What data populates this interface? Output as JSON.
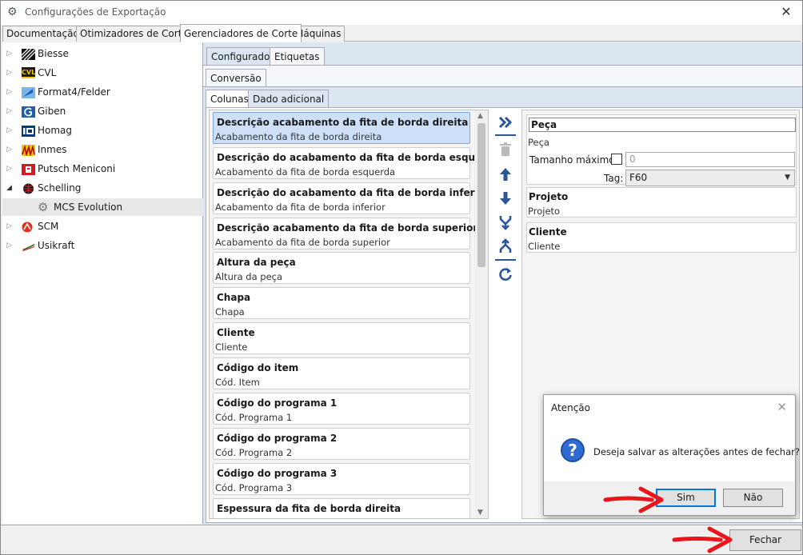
{
  "window": {
    "title": "Configurações de Exportação",
    "close": "✕"
  },
  "main_tabs": [
    {
      "label": "Documentação"
    },
    {
      "label": "Otimizadores de Corte"
    },
    {
      "label": "Gerenciadores de Corte"
    },
    {
      "label": "Máquinas"
    }
  ],
  "tree": [
    {
      "label": "Biesse"
    },
    {
      "label": "CVL"
    },
    {
      "label": "Format4/Felder"
    },
    {
      "label": "Giben"
    },
    {
      "label": "Homag"
    },
    {
      "label": "Inmes"
    },
    {
      "label": "Putsch Meniconi"
    },
    {
      "label": "Schelling"
    },
    {
      "label": "MCS Evolution"
    },
    {
      "label": "SCM"
    },
    {
      "label": "Usikraft"
    }
  ],
  "tree_logo_texts": {
    "cvl": "CVL"
  },
  "sub_tabs": [
    {
      "label": "Configurador"
    },
    {
      "label": "Etiquetas"
    }
  ],
  "conversion_tab": "Conversão",
  "column_tabs": [
    {
      "label": "Colunas"
    },
    {
      "label": "Dado adicional"
    }
  ],
  "columns": [
    {
      "title": "Descrição acabamento da fita de borda direita",
      "sub": "Acabamento da fita de borda direita"
    },
    {
      "title": "Descrição do acabamento da fita de borda esquerda",
      "sub": "Acabamento da fita de borda esquerda"
    },
    {
      "title": "Descrição do acabamento da fita de borda inferior",
      "sub": "Acabamento da fita de borda inferior"
    },
    {
      "title": "Descrição acabamento da fita de borda superior",
      "sub": "Acabamento da fita de borda superior"
    },
    {
      "title": "Altura da peça",
      "sub": "Altura da peça"
    },
    {
      "title": "Chapa",
      "sub": "Chapa"
    },
    {
      "title": "Cliente",
      "sub": "Cliente"
    },
    {
      "title": "Código do item",
      "sub": "Cód. Item"
    },
    {
      "title": "Código do programa 1",
      "sub": "Cód. Programa 1"
    },
    {
      "title": "Código do programa 2",
      "sub": "Cód. Programa 2"
    },
    {
      "title": "Código do programa 3",
      "sub": "Cód. Programa 3"
    },
    {
      "title": "Espessura da fita de borda direita",
      "sub": ""
    }
  ],
  "props": {
    "peca": {
      "input_value": "Peça",
      "sub": "Peça",
      "max_label": "Tamanho máximo:",
      "max_value": "0",
      "tag_label": "Tag:",
      "tag_value": "F60"
    },
    "projeto": {
      "title": "Projeto",
      "sub": "Projeto"
    },
    "cliente": {
      "title": "Cliente",
      "sub": "Cliente"
    }
  },
  "bottom": {
    "fechar": "Fechar"
  },
  "dialog": {
    "title": "Atenção",
    "message": "Deseja salvar as alterações antes de fechar?",
    "yes": "Sim",
    "no": "Não",
    "close": "✕",
    "icon_glyph": "?"
  },
  "colors": {
    "accent": "#0078d7",
    "annotation_arrow": "#e8161b",
    "selected_item": "#cde0f7",
    "panel_bg": "#dbe6f1"
  }
}
